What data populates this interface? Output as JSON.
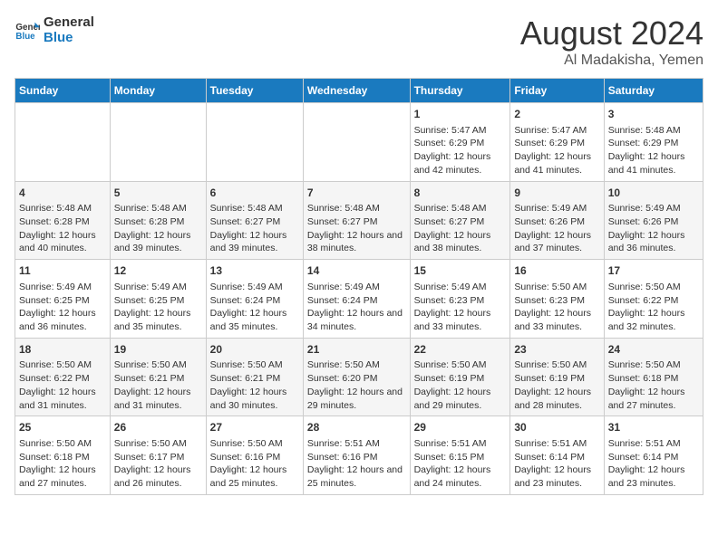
{
  "logo": {
    "line1": "General",
    "line2": "Blue"
  },
  "title": "August 2024",
  "location": "Al Madakisha, Yemen",
  "days_of_week": [
    "Sunday",
    "Monday",
    "Tuesday",
    "Wednesday",
    "Thursday",
    "Friday",
    "Saturday"
  ],
  "weeks": [
    [
      {
        "day": "",
        "sunrise": "",
        "sunset": "",
        "daylight": ""
      },
      {
        "day": "",
        "sunrise": "",
        "sunset": "",
        "daylight": ""
      },
      {
        "day": "",
        "sunrise": "",
        "sunset": "",
        "daylight": ""
      },
      {
        "day": "",
        "sunrise": "",
        "sunset": "",
        "daylight": ""
      },
      {
        "day": "1",
        "sunrise": "Sunrise: 5:47 AM",
        "sunset": "Sunset: 6:29 PM",
        "daylight": "Daylight: 12 hours and 42 minutes."
      },
      {
        "day": "2",
        "sunrise": "Sunrise: 5:47 AM",
        "sunset": "Sunset: 6:29 PM",
        "daylight": "Daylight: 12 hours and 41 minutes."
      },
      {
        "day": "3",
        "sunrise": "Sunrise: 5:48 AM",
        "sunset": "Sunset: 6:29 PM",
        "daylight": "Daylight: 12 hours and 41 minutes."
      }
    ],
    [
      {
        "day": "4",
        "sunrise": "Sunrise: 5:48 AM",
        "sunset": "Sunset: 6:28 PM",
        "daylight": "Daylight: 12 hours and 40 minutes."
      },
      {
        "day": "5",
        "sunrise": "Sunrise: 5:48 AM",
        "sunset": "Sunset: 6:28 PM",
        "daylight": "Daylight: 12 hours and 39 minutes."
      },
      {
        "day": "6",
        "sunrise": "Sunrise: 5:48 AM",
        "sunset": "Sunset: 6:27 PM",
        "daylight": "Daylight: 12 hours and 39 minutes."
      },
      {
        "day": "7",
        "sunrise": "Sunrise: 5:48 AM",
        "sunset": "Sunset: 6:27 PM",
        "daylight": "Daylight: 12 hours and 38 minutes."
      },
      {
        "day": "8",
        "sunrise": "Sunrise: 5:48 AM",
        "sunset": "Sunset: 6:27 PM",
        "daylight": "Daylight: 12 hours and 38 minutes."
      },
      {
        "day": "9",
        "sunrise": "Sunrise: 5:49 AM",
        "sunset": "Sunset: 6:26 PM",
        "daylight": "Daylight: 12 hours and 37 minutes."
      },
      {
        "day": "10",
        "sunrise": "Sunrise: 5:49 AM",
        "sunset": "Sunset: 6:26 PM",
        "daylight": "Daylight: 12 hours and 36 minutes."
      }
    ],
    [
      {
        "day": "11",
        "sunrise": "Sunrise: 5:49 AM",
        "sunset": "Sunset: 6:25 PM",
        "daylight": "Daylight: 12 hours and 36 minutes."
      },
      {
        "day": "12",
        "sunrise": "Sunrise: 5:49 AM",
        "sunset": "Sunset: 6:25 PM",
        "daylight": "Daylight: 12 hours and 35 minutes."
      },
      {
        "day": "13",
        "sunrise": "Sunrise: 5:49 AM",
        "sunset": "Sunset: 6:24 PM",
        "daylight": "Daylight: 12 hours and 35 minutes."
      },
      {
        "day": "14",
        "sunrise": "Sunrise: 5:49 AM",
        "sunset": "Sunset: 6:24 PM",
        "daylight": "Daylight: 12 hours and 34 minutes."
      },
      {
        "day": "15",
        "sunrise": "Sunrise: 5:49 AM",
        "sunset": "Sunset: 6:23 PM",
        "daylight": "Daylight: 12 hours and 33 minutes."
      },
      {
        "day": "16",
        "sunrise": "Sunrise: 5:50 AM",
        "sunset": "Sunset: 6:23 PM",
        "daylight": "Daylight: 12 hours and 33 minutes."
      },
      {
        "day": "17",
        "sunrise": "Sunrise: 5:50 AM",
        "sunset": "Sunset: 6:22 PM",
        "daylight": "Daylight: 12 hours and 32 minutes."
      }
    ],
    [
      {
        "day": "18",
        "sunrise": "Sunrise: 5:50 AM",
        "sunset": "Sunset: 6:22 PM",
        "daylight": "Daylight: 12 hours and 31 minutes."
      },
      {
        "day": "19",
        "sunrise": "Sunrise: 5:50 AM",
        "sunset": "Sunset: 6:21 PM",
        "daylight": "Daylight: 12 hours and 31 minutes."
      },
      {
        "day": "20",
        "sunrise": "Sunrise: 5:50 AM",
        "sunset": "Sunset: 6:21 PM",
        "daylight": "Daylight: 12 hours and 30 minutes."
      },
      {
        "day": "21",
        "sunrise": "Sunrise: 5:50 AM",
        "sunset": "Sunset: 6:20 PM",
        "daylight": "Daylight: 12 hours and 29 minutes."
      },
      {
        "day": "22",
        "sunrise": "Sunrise: 5:50 AM",
        "sunset": "Sunset: 6:19 PM",
        "daylight": "Daylight: 12 hours and 29 minutes."
      },
      {
        "day": "23",
        "sunrise": "Sunrise: 5:50 AM",
        "sunset": "Sunset: 6:19 PM",
        "daylight": "Daylight: 12 hours and 28 minutes."
      },
      {
        "day": "24",
        "sunrise": "Sunrise: 5:50 AM",
        "sunset": "Sunset: 6:18 PM",
        "daylight": "Daylight: 12 hours and 27 minutes."
      }
    ],
    [
      {
        "day": "25",
        "sunrise": "Sunrise: 5:50 AM",
        "sunset": "Sunset: 6:18 PM",
        "daylight": "Daylight: 12 hours and 27 minutes."
      },
      {
        "day": "26",
        "sunrise": "Sunrise: 5:50 AM",
        "sunset": "Sunset: 6:17 PM",
        "daylight": "Daylight: 12 hours and 26 minutes."
      },
      {
        "day": "27",
        "sunrise": "Sunrise: 5:50 AM",
        "sunset": "Sunset: 6:16 PM",
        "daylight": "Daylight: 12 hours and 25 minutes."
      },
      {
        "day": "28",
        "sunrise": "Sunrise: 5:51 AM",
        "sunset": "Sunset: 6:16 PM",
        "daylight": "Daylight: 12 hours and 25 minutes."
      },
      {
        "day": "29",
        "sunrise": "Sunrise: 5:51 AM",
        "sunset": "Sunset: 6:15 PM",
        "daylight": "Daylight: 12 hours and 24 minutes."
      },
      {
        "day": "30",
        "sunrise": "Sunrise: 5:51 AM",
        "sunset": "Sunset: 6:14 PM",
        "daylight": "Daylight: 12 hours and 23 minutes."
      },
      {
        "day": "31",
        "sunrise": "Sunrise: 5:51 AM",
        "sunset": "Sunset: 6:14 PM",
        "daylight": "Daylight: 12 hours and 23 minutes."
      }
    ]
  ]
}
